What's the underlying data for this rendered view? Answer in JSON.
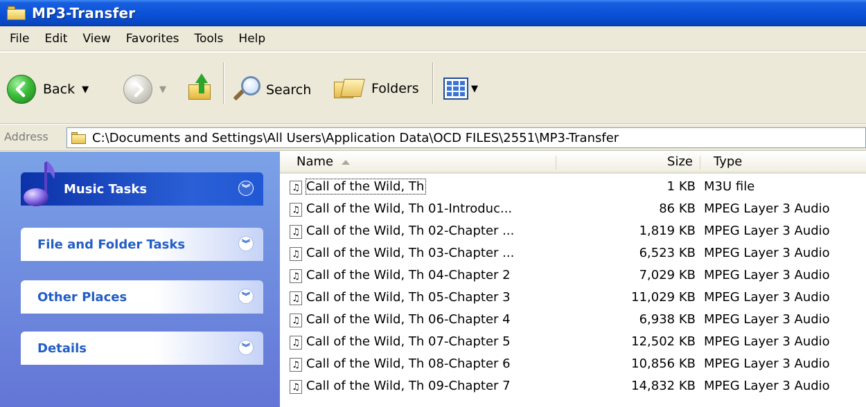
{
  "window": {
    "title": "MP3-Transfer"
  },
  "menu": [
    "File",
    "Edit",
    "View",
    "Favorites",
    "Tools",
    "Help"
  ],
  "toolbar": {
    "back_label": "Back",
    "search_label": "Search",
    "folders_label": "Folders"
  },
  "address": {
    "label": "Address",
    "path": "C:\\Documents and Settings\\All Users\\Application Data\\OCD FILES\\2551\\MP3-Transfer"
  },
  "task_pane": {
    "panels": [
      {
        "title": "Music Tasks"
      },
      {
        "title": "File and Folder Tasks"
      },
      {
        "title": "Other Places"
      },
      {
        "title": "Details"
      }
    ]
  },
  "file_list": {
    "columns": {
      "name": "Name",
      "size": "Size",
      "type": "Type"
    },
    "rows": [
      {
        "name": "Call of the Wild, Th",
        "size": "1 KB",
        "type": "M3U file"
      },
      {
        "name": "Call of the Wild, Th 01-Introduc...",
        "size": "86 KB",
        "type": "MPEG Layer 3 Audio"
      },
      {
        "name": "Call of the Wild, Th 02-Chapter ...",
        "size": "1,819 KB",
        "type": "MPEG Layer 3 Audio"
      },
      {
        "name": "Call of the Wild, Th 03-Chapter ...",
        "size": "6,523 KB",
        "type": "MPEG Layer 3 Audio"
      },
      {
        "name": "Call of the Wild, Th 04-Chapter 2",
        "size": "7,029 KB",
        "type": "MPEG Layer 3 Audio"
      },
      {
        "name": "Call of the Wild, Th 05-Chapter 3",
        "size": "11,029 KB",
        "type": "MPEG Layer 3 Audio"
      },
      {
        "name": "Call of the Wild, Th 06-Chapter 4",
        "size": "6,938 KB",
        "type": "MPEG Layer 3 Audio"
      },
      {
        "name": "Call of the Wild, Th 07-Chapter 5",
        "size": "12,502 KB",
        "type": "MPEG Layer 3 Audio"
      },
      {
        "name": "Call of the Wild, Th 08-Chapter 6",
        "size": "10,856 KB",
        "type": "MPEG Layer 3 Audio"
      },
      {
        "name": "Call of the Wild, Th 09-Chapter 7",
        "size": "14,832 KB",
        "type": "MPEG Layer 3 Audio"
      }
    ]
  }
}
